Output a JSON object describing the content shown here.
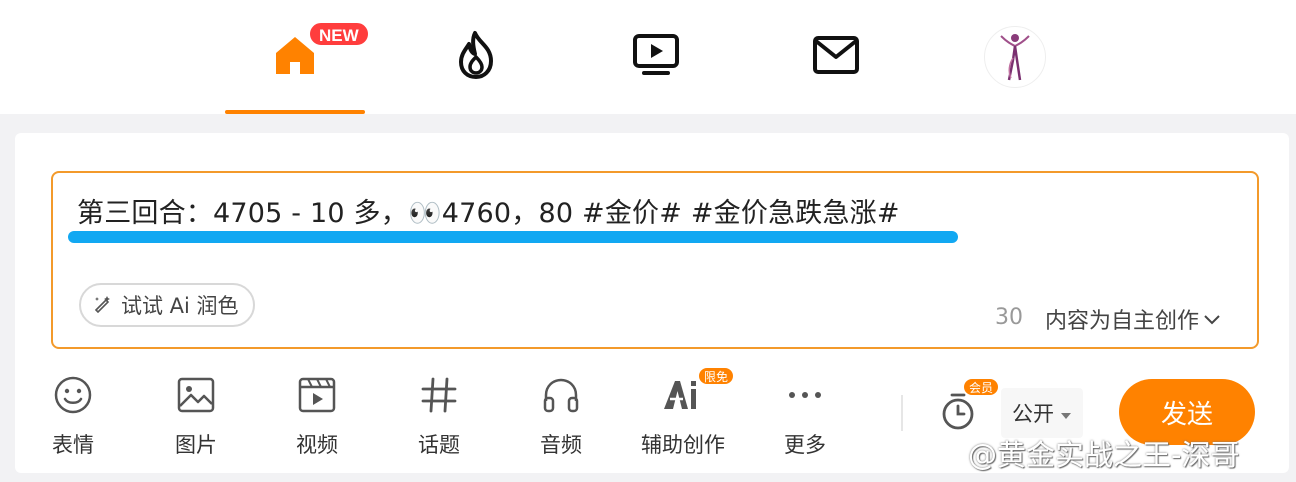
{
  "nav": {
    "items": [
      {
        "name": "home",
        "icon": "home-icon",
        "active": true
      },
      {
        "name": "hot",
        "icon": "fire-icon"
      },
      {
        "name": "video",
        "icon": "video-play-icon"
      },
      {
        "name": "messages",
        "icon": "mail-icon"
      },
      {
        "name": "profile",
        "icon": "avatar"
      }
    ],
    "new_badge": "NEW"
  },
  "composer": {
    "text": "第三回合：4705 - 10 多，👀4760，80 #金价# #金价急跌急涨#",
    "ai_polish_label": "试试 Ai 润色",
    "char_count": "30",
    "creation_type": "内容为自主创作"
  },
  "toolbar": {
    "items": [
      {
        "label": "表情",
        "icon": "emoji-icon"
      },
      {
        "label": "图片",
        "icon": "image-icon"
      },
      {
        "label": "视频",
        "icon": "video-icon"
      },
      {
        "label": "话题",
        "icon": "hashtag-icon"
      },
      {
        "label": "音频",
        "icon": "headphones-icon"
      },
      {
        "label": "辅助创作",
        "icon": "ai-icon"
      },
      {
        "label": "更多",
        "icon": "more-icon"
      }
    ],
    "free_badge": "限免",
    "vip_badge": "会员",
    "privacy": "公开",
    "send": "发送"
  },
  "watermark": "@黄金实战之王-深哥",
  "colors": {
    "accent": "#ff8200",
    "highlight": "#12a8f2",
    "badge_red": "#ff3d3d"
  }
}
